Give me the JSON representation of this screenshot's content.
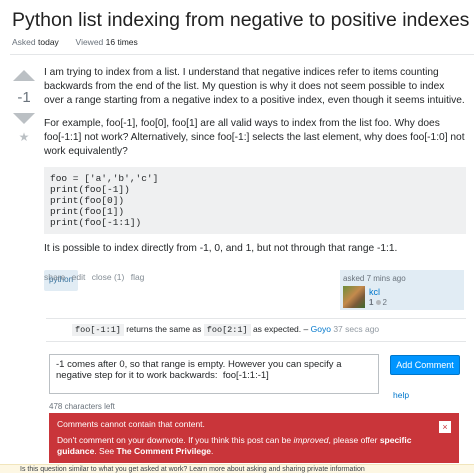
{
  "question": {
    "title": "Python list indexing from negative to positive indexes",
    "asked_label": "Asked",
    "asked_value": "today",
    "viewed_label": "Viewed",
    "viewed_value": "16 times",
    "vote_count": "-1",
    "body_p1": "I am trying to index from a list. I understand that negative indices refer to items counting backwards from the end of the list. My question is why it does not seem possible to index over a range starting from a negative index to a positive index, even though it seems intuitive.",
    "body_p2": "For example, foo[-1], foo[0], foo[1] are all valid ways to index from the list foo. Why does foo[-1:1] not work? Alternatively, since foo[-1:] selects the last element, why does foo[-1:0] not work equivalently?",
    "code_lines": [
      "foo = ['a','b','c']",
      "print(foo[-1])",
      "print(foo[0])",
      "print(foo[1])",
      "print(foo[-1:1])"
    ],
    "body_p3": "It is possible to index directly from -1, 0, and 1, but not through that range -1:1.",
    "tag": "python"
  },
  "post_menu": {
    "share": "share",
    "edit": "edit",
    "close": "close (1)",
    "flag": "flag"
  },
  "owner": {
    "asked_time": "asked 7 mins ago",
    "name": "kcl",
    "rep": "1",
    "bronze": "2"
  },
  "comments": [
    {
      "code1": "foo[-1:1]",
      "text_mid": " returns the same as ",
      "code2": "foo[2:1]",
      "text_end": " as expected. –",
      "user": "Goyo",
      "date": "37 secs ago"
    }
  ],
  "comment_form": {
    "text": "-1 comes after 0, so that range is empty. However you can specify a negative step for it to work backwards:  foo[-1:1:-1]",
    "button": "Add Comment",
    "help": "help",
    "chars_left": "478 characters left"
  },
  "alert": {
    "line1": "Comments cannot contain that content.",
    "line2_a": "Don't comment on your downvote. If you think this post can be",
    "line2_em": "improved",
    "line2_b": ", please offer",
    "line2_bold1": "specific guidance",
    "line2_c": ". See",
    "line2_bold2": "The Comment Privilege",
    "line2_d": ".",
    "close": "×"
  },
  "bottom_bar": {
    "text": "Is this question similar to what you get asked at work? Learn more about asking and sharing private information"
  },
  "colors": {
    "accent": "#0095ff",
    "link": "#0077cc",
    "alert": "#c9353a",
    "tag_bg": "#e1ecf4"
  }
}
